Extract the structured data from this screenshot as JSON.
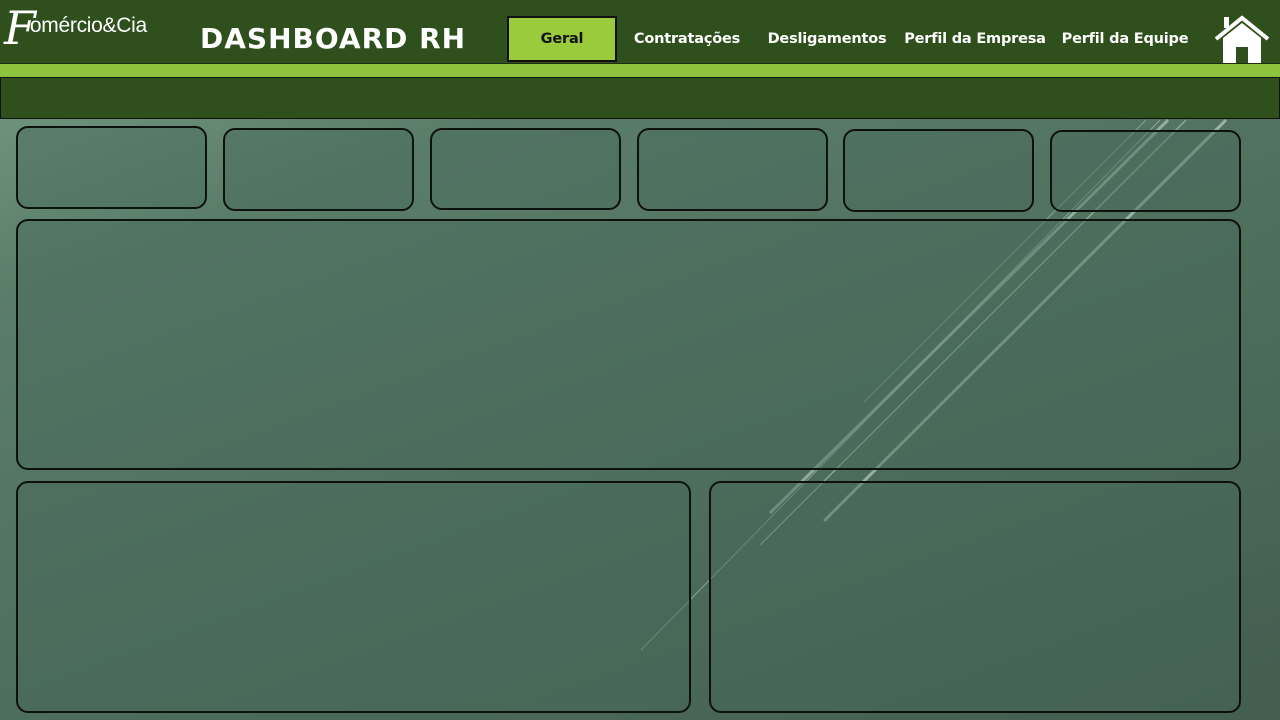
{
  "header": {
    "logo_mark": "F",
    "logo_text": "omércio&Cia",
    "title": "DASHBOARD RH"
  },
  "nav": {
    "tabs": [
      {
        "label": "Geral",
        "active": true
      },
      {
        "label": "Contratações",
        "active": false
      },
      {
        "label": "Desligamentos",
        "active": false
      },
      {
        "label": "Perfil da Empresa",
        "active": false
      },
      {
        "label": "Perfil da Equipe",
        "active": false
      }
    ],
    "home_icon": "home-icon"
  },
  "colors": {
    "header_bg": "#2f501d",
    "accent": "#9acb3c",
    "accent_strip": "#8fc23c",
    "text_light": "#ffffff",
    "card_border": "#0d120e"
  }
}
